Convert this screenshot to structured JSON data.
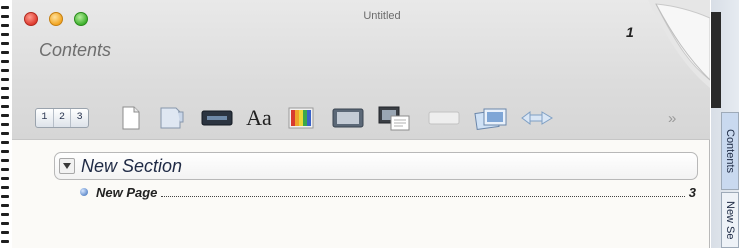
{
  "window": {
    "title": "Untitled",
    "contents_title": "Contents",
    "page_number": "1"
  },
  "toolbar": {
    "numbers": [
      "1",
      "2",
      "3"
    ],
    "font_label": "Aa",
    "overflow": "»",
    "icons": [
      "page-numbering-icon",
      "blank-page-icon",
      "divider-tab-icon",
      "field-icon",
      "font-icon",
      "color-swatches-icon",
      "image-icon",
      "multimedia-icon",
      "blank-label-icon",
      "photo-stack-icon",
      "link-arrow-icon"
    ]
  },
  "outline": {
    "section_label": "New Section",
    "page_label": "New Page",
    "page_ref": "3"
  },
  "side_tabs": [
    "Contents",
    "New Se"
  ],
  "colors": {
    "accent_blue": "#5a86c8",
    "close": "#de3c30",
    "minimize": "#f2a623",
    "zoom": "#3fb12e"
  }
}
